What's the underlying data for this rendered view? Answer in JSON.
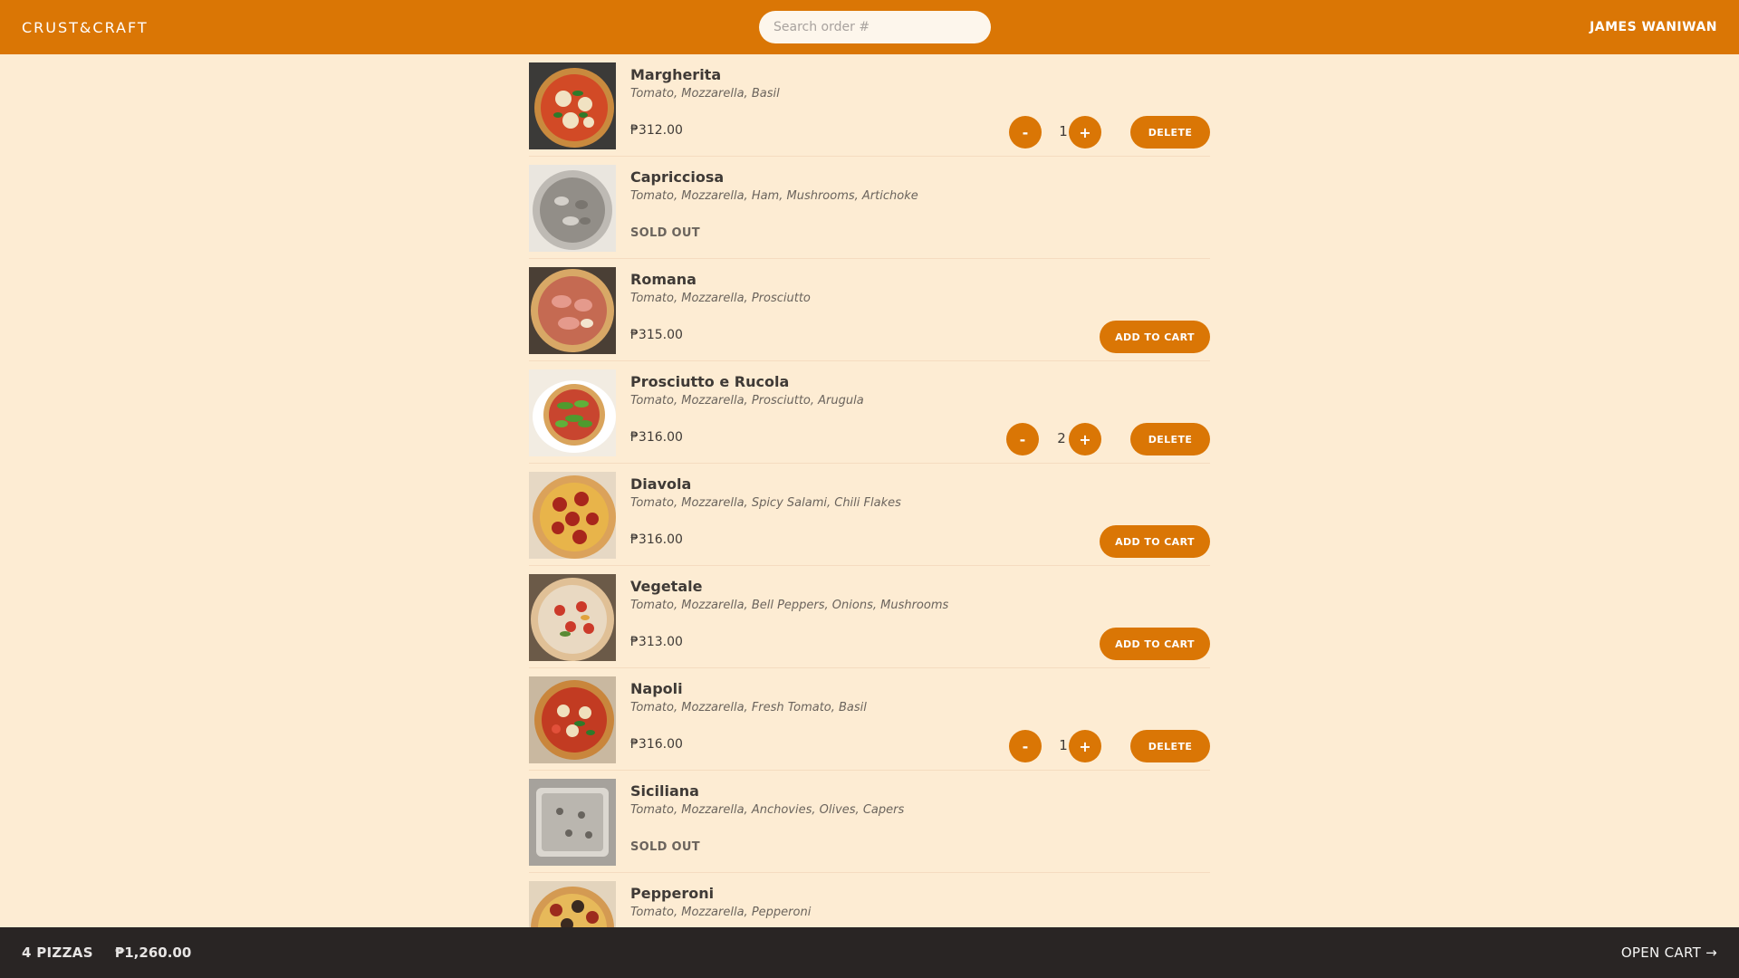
{
  "header": {
    "logo": "CRUST&CRAFT",
    "search_placeholder": "Search order #",
    "user_name": "JAMES WANIWAN"
  },
  "menu": [
    {
      "name": "Margherita",
      "ingredients": "Tomato, Mozzarella, Basil",
      "price": "₱312.00",
      "sold_out": false,
      "in_cart": true,
      "quantity": "1",
      "image": "pizza-margherita-image"
    },
    {
      "name": "Capricciosa",
      "ingredients": "Tomato, Mozzarella, Ham, Mushrooms, Artichoke",
      "sold_out": true,
      "status": "SOLD OUT",
      "image": "pizza-capricciosa-image"
    },
    {
      "name": "Romana",
      "ingredients": "Tomato, Mozzarella, Prosciutto",
      "price": "₱315.00",
      "sold_out": false,
      "in_cart": false,
      "image": "pizza-romana-image"
    },
    {
      "name": "Prosciutto e Rucola",
      "ingredients": "Tomato, Mozzarella, Prosciutto, Arugula",
      "price": "₱316.00",
      "sold_out": false,
      "in_cart": true,
      "quantity": "2",
      "image": "pizza-prosciutto-rucola-image"
    },
    {
      "name": "Diavola",
      "ingredients": "Tomato, Mozzarella, Spicy Salami, Chili Flakes",
      "price": "₱316.00",
      "sold_out": false,
      "in_cart": false,
      "image": "pizza-diavola-image"
    },
    {
      "name": "Vegetale",
      "ingredients": "Tomato, Mozzarella, Bell Peppers, Onions, Mushrooms",
      "price": "₱313.00",
      "sold_out": false,
      "in_cart": false,
      "image": "pizza-vegetale-image"
    },
    {
      "name": "Napoli",
      "ingredients": "Tomato, Mozzarella, Fresh Tomato, Basil",
      "price": "₱316.00",
      "sold_out": false,
      "in_cart": true,
      "quantity": "1",
      "image": "pizza-napoli-image"
    },
    {
      "name": "Siciliana",
      "ingredients": "Tomato, Mozzarella, Anchovies, Olives, Capers",
      "sold_out": true,
      "status": "SOLD OUT",
      "image": "pizza-siciliana-image"
    },
    {
      "name": "Pepperoni",
      "ingredients": "Tomato, Mozzarella, Pepperoni",
      "image": "pizza-pepperoni-image"
    }
  ],
  "buttons": {
    "decrease": "-",
    "increase": "+",
    "delete": "DELETE",
    "add_to_cart": "ADD TO CART"
  },
  "footer": {
    "count": "4 PIZZAS",
    "total": "₱1,260.00",
    "open_cart": "OPEN CART →"
  },
  "colors": {
    "accent": "#da7605",
    "background": "#fdecd3",
    "footer": "#292524"
  }
}
